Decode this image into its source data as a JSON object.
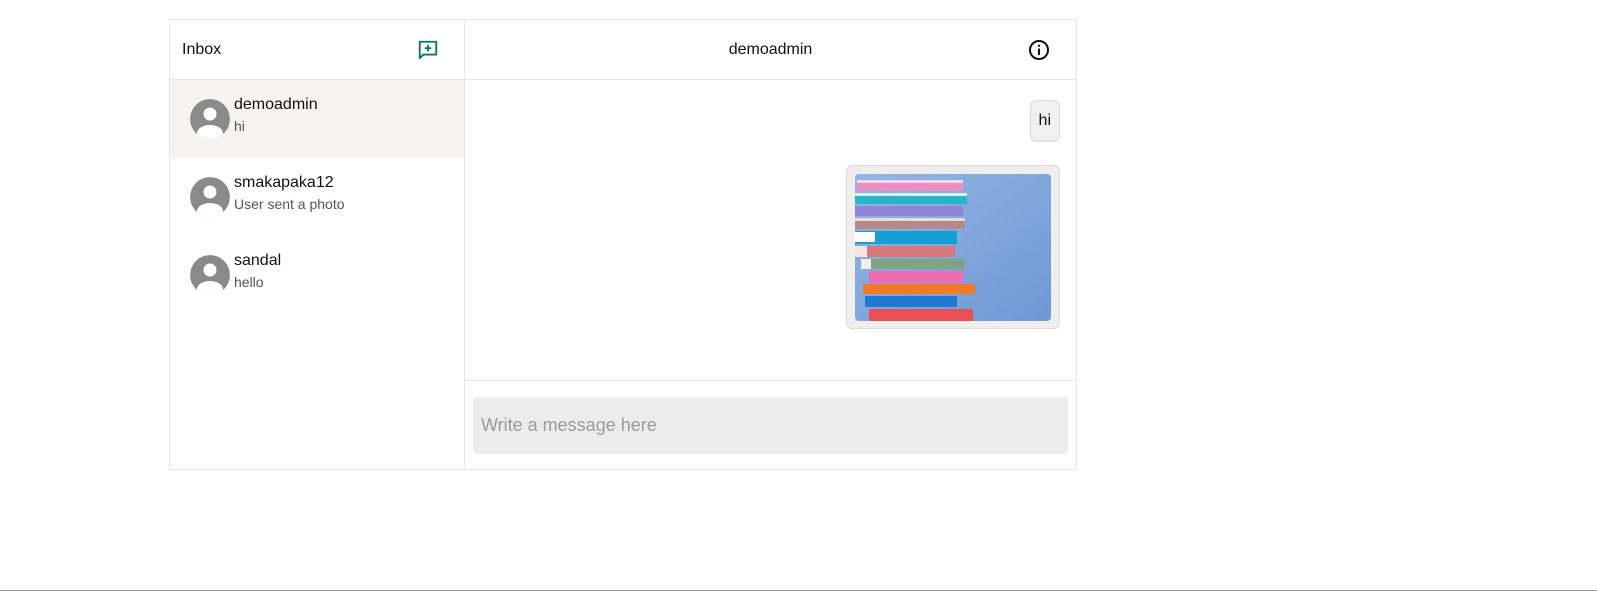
{
  "sidebar": {
    "title": "Inbox",
    "new_message_icon": "add-comment-icon",
    "threads": [
      {
        "name": "demoadmin",
        "preview": "hi",
        "active": true,
        "avatar_icon": "default-avatar-icon"
      },
      {
        "name": "smakapaka12",
        "preview": "User sent a photo",
        "active": false,
        "avatar_icon": "default-avatar-icon"
      },
      {
        "name": "sandal",
        "preview": "hello",
        "active": false,
        "avatar_icon": "default-avatar-icon"
      }
    ]
  },
  "chat": {
    "title": "demoadmin",
    "info_icon": "info-icon",
    "messages": [
      {
        "type": "text",
        "text": "hi"
      },
      {
        "type": "photo",
        "subject": "stack-of-books-photo"
      }
    ]
  },
  "composer": {
    "placeholder": "Write a message here"
  },
  "colors": {
    "accent": "#00796b",
    "active_thread_bg": "#f5f4f2",
    "avatar_gray": "#8a8a8a",
    "input_bg": "#ececec"
  }
}
